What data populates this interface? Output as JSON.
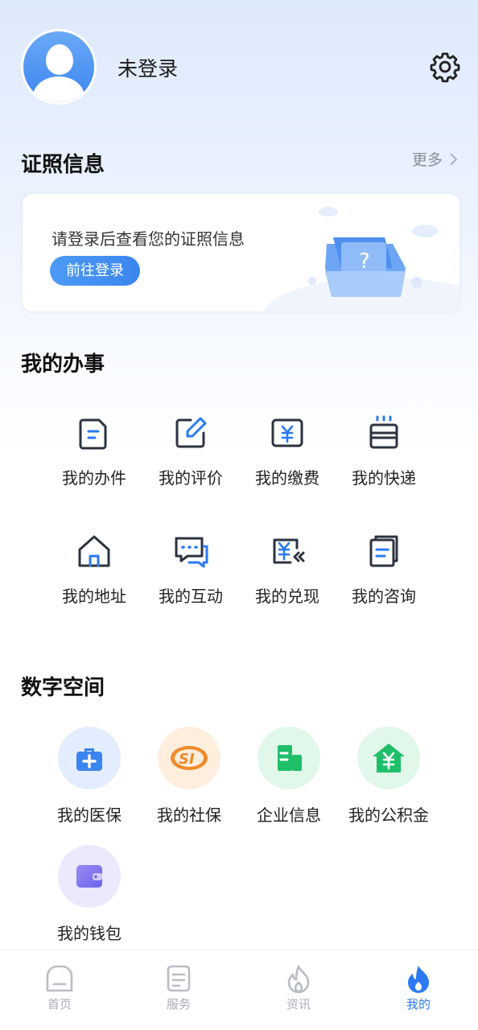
{
  "header": {
    "login_status": "未登录"
  },
  "certificates": {
    "title": "证照信息",
    "more_label": "更多",
    "hint": "请登录后查看您的证照信息",
    "login_button": "前往登录"
  },
  "affairs": {
    "title": "我的办事",
    "items": [
      {
        "label": "我的办件",
        "icon": "document-icon"
      },
      {
        "label": "我的评价",
        "icon": "edit-icon"
      },
      {
        "label": "我的缴费",
        "icon": "payment-icon"
      },
      {
        "label": "我的快递",
        "icon": "express-icon"
      },
      {
        "label": "我的地址",
        "icon": "house-icon"
      },
      {
        "label": "我的互动",
        "icon": "chat-icon"
      },
      {
        "label": "我的兑现",
        "icon": "cash-icon"
      },
      {
        "label": "我的咨询",
        "icon": "files-icon"
      }
    ]
  },
  "digital_space": {
    "title": "数字空间",
    "items": [
      {
        "label": "我的医保",
        "icon": "medical-kit-icon",
        "bg": "#e3edfd",
        "color": "#3b86ee"
      },
      {
        "label": "我的社保",
        "icon": "social-security-icon",
        "bg": "#fdeede",
        "color": "#f08a2c"
      },
      {
        "label": "企业信息",
        "icon": "building-icon",
        "bg": "#e1f7ea",
        "color": "#1fbf6a"
      },
      {
        "label": "我的公积金",
        "icon": "housing-fund-icon",
        "bg": "#e1f7ea",
        "color": "#1fbf6a"
      },
      {
        "label": "我的钱包",
        "icon": "wallet-icon",
        "bg": "#ebe9fb",
        "color": "#7d75ee"
      }
    ]
  },
  "tabbar": {
    "tabs": [
      {
        "label": "首页",
        "icon": "home-icon",
        "active": false
      },
      {
        "label": "服务",
        "icon": "service-icon",
        "active": false
      },
      {
        "label": "资讯",
        "icon": "flame-outline-icon",
        "active": false
      },
      {
        "label": "我的",
        "icon": "flame-icon",
        "active": true
      }
    ],
    "active_color": "#2b7af1",
    "inactive_color": "#a9adb5"
  }
}
